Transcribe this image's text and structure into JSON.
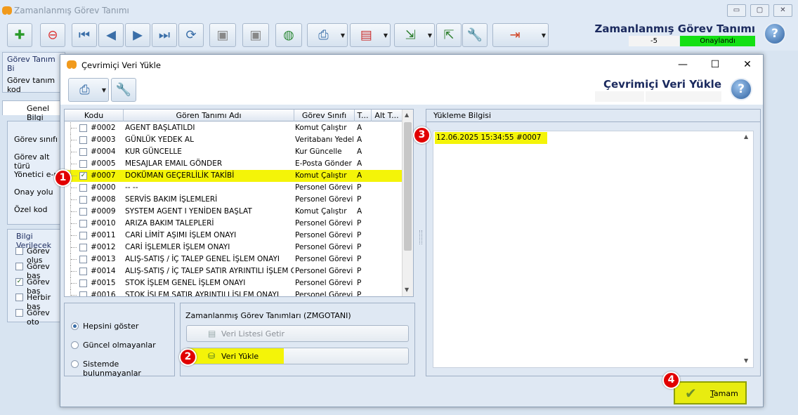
{
  "main": {
    "title": "Zamanlanmış Görev Tanımı",
    "heading": "Zamanlanmış Görev Tanımı",
    "record_no": "-5",
    "status": "Onaylandı",
    "window_buttons": [
      "▭",
      "▢",
      "✕"
    ],
    "panels": {
      "gorev_tanim": "Görev Tanım Bi",
      "gorev_tanim_kodu": "Görev tanım kod",
      "tab_genel": "Genel Bilgi",
      "fields": [
        "Görev sınıfı",
        "Görev alt türü",
        "Yönetici e-p",
        "Onay yolu",
        "Özel kod"
      ],
      "bilgi_title": "Bilgi Verilecek",
      "bilgi_items": [
        {
          "label": "Görev olus",
          "checked": false
        },
        {
          "label": "Görev baş",
          "checked": false
        },
        {
          "label": "Görev baş",
          "checked": true
        },
        {
          "label": "Herbir baş",
          "checked": false
        },
        {
          "label": "Görev oto",
          "checked": false
        }
      ]
    }
  },
  "dialog": {
    "title": "Çevrimiçi Veri Yükle",
    "heading": "Çevrimiçi Veri Yükle",
    "grid": {
      "columns": [
        "Kodu",
        "Gören Tanımı Adı",
        "Görev Sınıfı",
        "T...",
        "Alt T..."
      ],
      "rows": [
        {
          "kodu": "#0002",
          "ad": "AGENT BAŞLATILDI",
          "sinif": "Komut Çalıştır",
          "t": "A",
          "checked": false,
          "selected": false
        },
        {
          "kodu": "#0003",
          "ad": "GÜNLÜK YEDEK AL",
          "sinif": "Veritabanı Yedek Al",
          "t": "A",
          "checked": false,
          "selected": false
        },
        {
          "kodu": "#0004",
          "ad": "KUR GÜNCELLE",
          "sinif": "Kur Güncelle",
          "t": "A",
          "checked": false,
          "selected": false
        },
        {
          "kodu": "#0005",
          "ad": "MESAJLAR EMAIL GÖNDER",
          "sinif": "E-Posta Gönder",
          "t": "A",
          "checked": false,
          "selected": false
        },
        {
          "kodu": "#0007",
          "ad": "DOKÜMAN GEÇERLİLİK TAKİBİ",
          "sinif": "Komut Çalıştır",
          "t": "A",
          "checked": true,
          "selected": true
        },
        {
          "kodu": "#0000",
          "ad": "-- --",
          "sinif": "Personel Görevi",
          "t": "P",
          "checked": false,
          "selected": false
        },
        {
          "kodu": "#0008",
          "ad": "SERVİS BAKIM İŞLEMLERİ",
          "sinif": "Personel Görevi",
          "t": "P",
          "checked": false,
          "selected": false
        },
        {
          "kodu": "#0009",
          "ad": "SYSTEM AGENT I YENİDEN BAŞLAT",
          "sinif": "Komut Çalıştır",
          "t": "A",
          "checked": false,
          "selected": false
        },
        {
          "kodu": "#0010",
          "ad": "ARIZA BAKIM TALEPLERİ",
          "sinif": "Personel Görevi",
          "t": "P",
          "checked": false,
          "selected": false
        },
        {
          "kodu": "#0011",
          "ad": "CARİ LİMİT AŞIMI İŞLEM ONAYI",
          "sinif": "Personel Görevi",
          "t": "P",
          "checked": false,
          "selected": false
        },
        {
          "kodu": "#0012",
          "ad": "CARİ İŞLEMLER İŞLEM ONAYI",
          "sinif": "Personel Görevi",
          "t": "P",
          "checked": false,
          "selected": false
        },
        {
          "kodu": "#0013",
          "ad": "ALIŞ-SATIŞ / İÇ TALEP GENEL İŞLEM ONAYI",
          "sinif": "Personel Görevi",
          "t": "P",
          "checked": false,
          "selected": false
        },
        {
          "kodu": "#0014",
          "ad": "ALIŞ-SATIŞ / İÇ TALEP SATIR AYRINTILI İŞLEM ONAYI",
          "sinif": "Personel Görevi",
          "t": "P",
          "checked": false,
          "selected": false
        },
        {
          "kodu": "#0015",
          "ad": "STOK  İŞLEM GENEL İŞLEM ONAYI",
          "sinif": "Personel Görevi",
          "t": "P",
          "checked": false,
          "selected": false
        },
        {
          "kodu": "#0016",
          "ad": "STOK  İŞLEM SATIR AYRINTILI İŞLEM ONAYI",
          "sinif": "Personel Görevi",
          "t": "P",
          "checked": false,
          "selected": false
        }
      ]
    },
    "filter_options": [
      {
        "label": "Hepsini göster",
        "selected": true
      },
      {
        "label": "Güncel olmayanlar",
        "selected": false
      },
      {
        "label": "Sistemde bulunmayanlar",
        "selected": false
      }
    ],
    "actions_title": "Zamanlanmış Görev Tanımları (ZMGOTANI)",
    "btn_veri_listesi": "Veri Listesi Getir",
    "btn_veri_yukle": "Veri Yükle",
    "upload_title": "Yükleme Bilgisi",
    "upload_log": "12.06.2025 15:34:55 #0007",
    "ok_label": "Tamam",
    "window_buttons": [
      "—",
      "☐",
      "✕"
    ]
  },
  "markers": [
    "1",
    "2",
    "3",
    "4"
  ],
  "colors": {
    "highlight": "#f4f408",
    "status_green": "#14e014",
    "marker_red": "#e10000",
    "heading_navy": "#1b2a5e"
  },
  "icons": [
    "add-icon",
    "delete-icon",
    "first-icon",
    "prev-icon",
    "next-icon",
    "last-icon",
    "refresh-icon",
    "save-icon",
    "save-close-icon",
    "web-icon",
    "print-icon",
    "pdf-icon",
    "export-icon",
    "import-icon",
    "settings-icon",
    "exit-icon",
    "help-icon",
    "checkmark-icon"
  ]
}
